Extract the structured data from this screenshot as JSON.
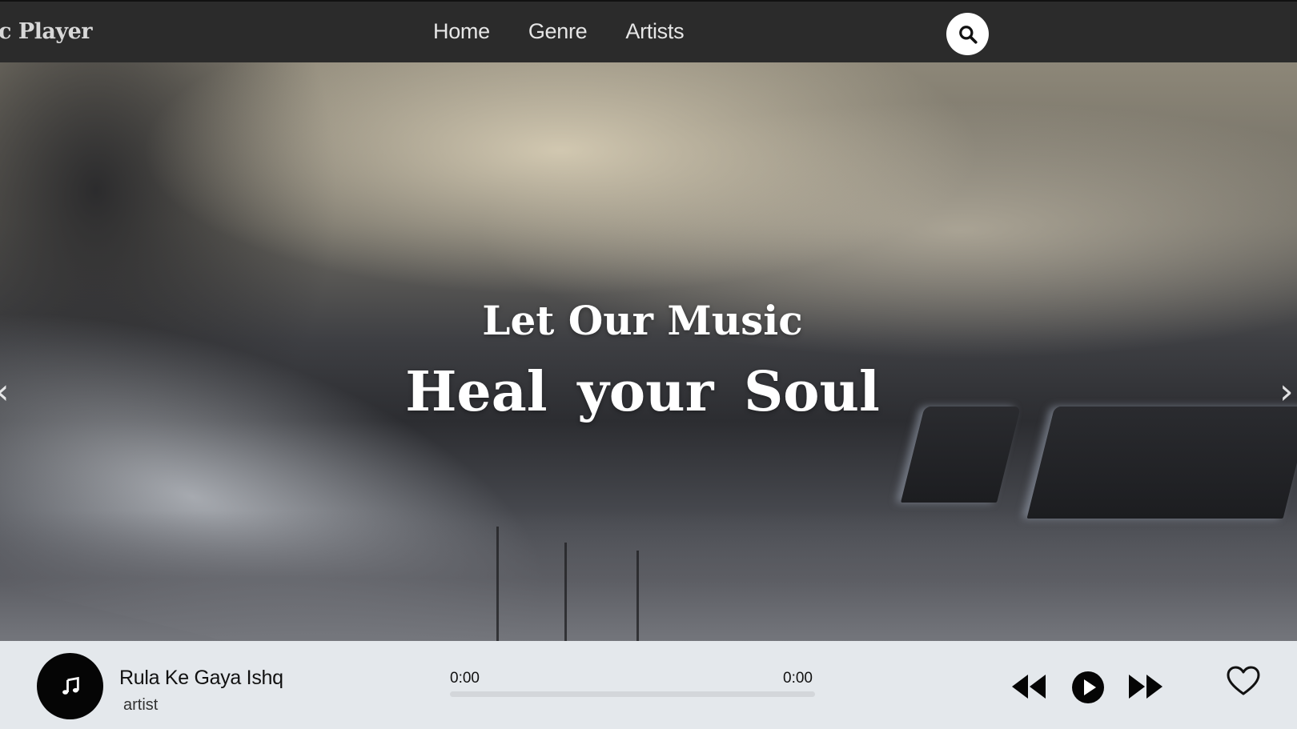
{
  "navbar": {
    "brand": "c Player",
    "links": [
      "Home",
      "Genre",
      "Artists"
    ],
    "search_icon": "search-icon"
  },
  "hero": {
    "line1": "Let Our Music",
    "line2": "Heal  your  Soul",
    "prev_arrow": "‹",
    "next_arrow": "›"
  },
  "player": {
    "song_title": "Rula Ke Gaya Ishq",
    "artist": "artist",
    "current_time": "0:00",
    "total_time": "0:00",
    "progress": 0,
    "icons": {
      "album": "music-note-icon",
      "prev": "rewind-icon",
      "play": "play-icon",
      "next": "fast-forward-icon",
      "like": "heart-icon"
    }
  },
  "colors": {
    "navbar_bg": "#2b2b2b",
    "player_bg": "#e4e8ec",
    "text_light": "#ffffff",
    "icon_dark": "#050505"
  }
}
